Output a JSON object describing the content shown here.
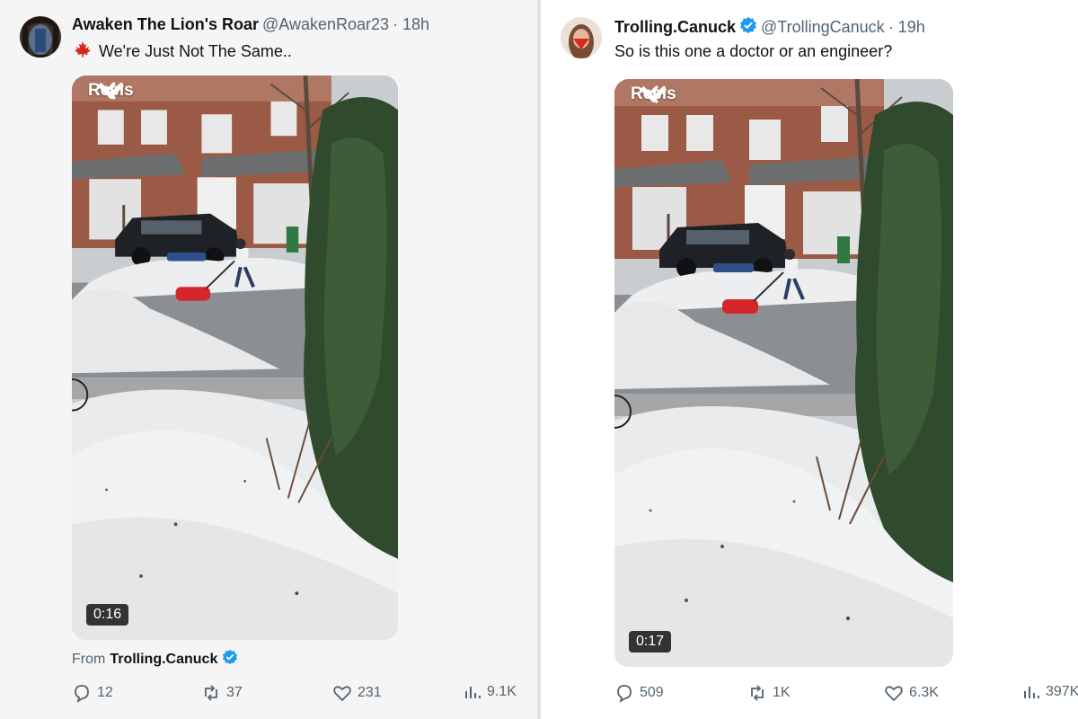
{
  "tweets": [
    {
      "author": "Awaken The Lion's Roar",
      "handle": "@AwakenRoar23",
      "time": "· 18h",
      "flag_emoji": "🍁",
      "text": "We're Just Not The Same..",
      "media": {
        "reels_label": "Reels",
        "duration": "0:16"
      },
      "from_prefix": "From",
      "from_name": "Trolling.Canuck",
      "replies": "12",
      "retweets": "37",
      "likes": "231",
      "views": "9.1K"
    },
    {
      "author": "Trolling.Canuck",
      "handle": "@TrollingCanuck",
      "time": "· 19h",
      "text": "So is this one a doctor or an engineer?",
      "media": {
        "reels_label": "Reels",
        "duration": "0:17"
      },
      "replies": "509",
      "retweets": "1K",
      "likes": "6.3K",
      "views": "397K"
    }
  ],
  "colors": {
    "verified": "#1d9bf0",
    "text_primary": "#0f1419",
    "text_secondary": "#536471",
    "flag_red": "#d52b1e"
  },
  "icons": [
    "verified-badge-icon",
    "reply-icon",
    "retweet-icon",
    "like-icon",
    "views-icon",
    "back-chevron-icon",
    "search-icon",
    "dropdown-chevron-icon",
    "maple-leaf-icon"
  ]
}
